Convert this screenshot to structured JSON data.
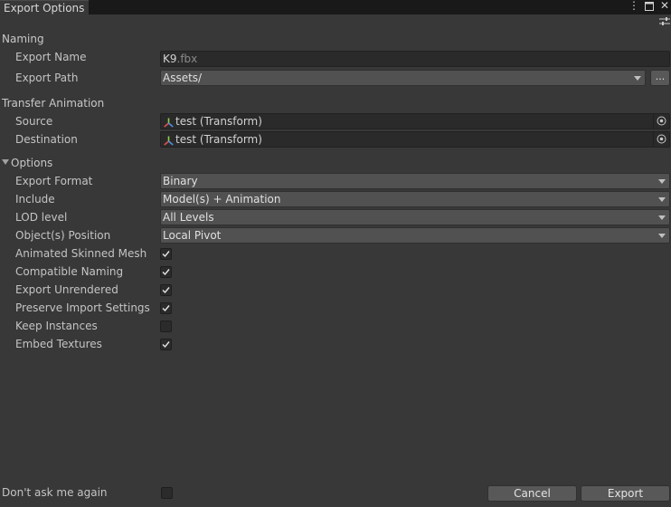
{
  "window": {
    "tab_title": "Export Options",
    "menu_icon": "kebab-menu-icon",
    "maximize_icon": "maximize-icon",
    "close_icon": "close-icon"
  },
  "header": {
    "settings_icon": "sliders-icon"
  },
  "naming": {
    "title": "Naming",
    "export_name_label": "Export Name",
    "export_name_value": "K9",
    "export_name_ext": ".fbx",
    "export_path_label": "Export Path",
    "export_path_value": "Assets/",
    "browse_label": "..."
  },
  "transfer": {
    "title": "Transfer Animation",
    "source_label": "Source",
    "source_value": "test (Transform)",
    "destination_label": "Destination",
    "destination_value": "test (Transform)"
  },
  "options": {
    "title": "Options",
    "export_format_label": "Export Format",
    "export_format_value": "Binary",
    "include_label": "Include",
    "include_value": "Model(s) + Animation",
    "lod_label": "LOD level",
    "lod_value": "All Levels",
    "position_label": "Object(s) Position",
    "position_value": "Local Pivot",
    "toggles": [
      {
        "label": "Animated Skinned Mesh",
        "checked": true
      },
      {
        "label": "Compatible Naming",
        "checked": true
      },
      {
        "label": "Export Unrendered",
        "checked": true
      },
      {
        "label": "Preserve Import Settings",
        "checked": true
      },
      {
        "label": "Keep Instances",
        "checked": false
      },
      {
        "label": "Embed Textures",
        "checked": true
      }
    ]
  },
  "footer": {
    "dont_ask_label": "Don't ask me again",
    "dont_ask_checked": false,
    "cancel_label": "Cancel",
    "export_label": "Export"
  },
  "colors": {
    "background": "#383838",
    "field": "#2a2a2a",
    "dropdown": "#515151",
    "button": "#585858"
  }
}
